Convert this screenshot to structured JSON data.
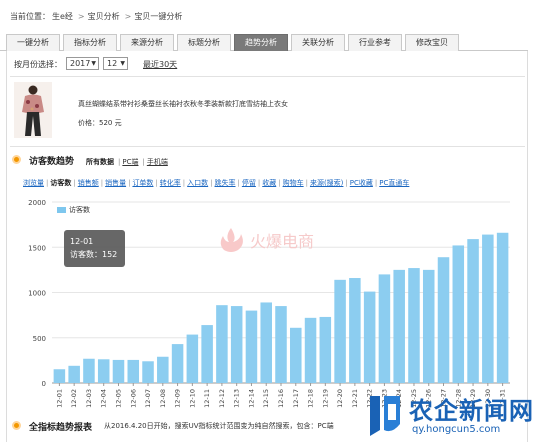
{
  "breadcrumb": {
    "prefix": "当前位置：",
    "items": [
      "生e经",
      "宝贝分析",
      "宝贝一键分析"
    ]
  },
  "tabs": [
    {
      "label": "一键分析",
      "active": false
    },
    {
      "label": "指标分析",
      "active": false
    },
    {
      "label": "来源分析",
      "active": false
    },
    {
      "label": "标题分析",
      "active": false
    },
    {
      "label": "趋势分析",
      "active": true
    },
    {
      "label": "关联分析",
      "active": false
    },
    {
      "label": "行业参考",
      "active": false
    },
    {
      "label": "修改宝贝",
      "active": false
    }
  ],
  "month_filter": {
    "label": "按月份选择：",
    "year": "2017",
    "month": "12",
    "recent_link": "最近30天"
  },
  "product": {
    "title": "真丝蝴蝶结系带衬衫桑蚕丝长袖衬衣秋冬季装新款打底雪纺袖上衣女",
    "price": "价格：520 元"
  },
  "section": {
    "title": "访客数趋势",
    "sub_tabs": [
      "所有数据",
      "PC端",
      "手机端"
    ],
    "active_sub_tab": 0
  },
  "metrics": [
    "浏览量",
    "访客数",
    "销售额",
    "销售量",
    "订单数",
    "转化率",
    "入口数",
    "跳失率",
    "停留",
    "收藏",
    "购物车",
    "来源(搜索)",
    "PC收藏",
    "PC直通车"
  ],
  "active_metric": 1,
  "plain_metric_prefix": "来源(",
  "legend_label": "访客数",
  "tooltip": {
    "date": "12-01",
    "text": "访客数：152"
  },
  "watermark": "火爆电商",
  "footer": {
    "title": "全指标趋势报表",
    "note": "从2016.4.20日开始，搜索UV指标统计范围变为纯自然搜索，包含：PC端"
  },
  "logo": {
    "text": "农企新闻网",
    "sub": "qy.hongcun5.com"
  },
  "colors": {
    "bar": "#8ccdf0",
    "accent": "#f39800",
    "tab_active": "#7a7a7a",
    "link": "#1a66c0"
  },
  "chart_data": {
    "type": "bar",
    "series": [
      {
        "name": "访客数",
        "values": [
          152,
          190,
          268,
          262,
          255,
          255,
          240,
          290,
          430,
          535,
          640,
          860,
          850,
          800,
          890,
          850,
          610,
          720,
          730,
          1140,
          1160,
          1010,
          1200,
          1250,
          1270,
          1250,
          1390,
          1520,
          1590,
          1640,
          1660
        ]
      }
    ],
    "categories": [
      "12-01",
      "12-02",
      "12-03",
      "12-04",
      "12-05",
      "12-06",
      "12-07",
      "12-08",
      "12-09",
      "12-10",
      "12-11",
      "12-12",
      "12-13",
      "12-14",
      "12-15",
      "12-16",
      "12-17",
      "12-18",
      "12-19",
      "12-20",
      "12-21",
      "12-22",
      "12-23",
      "12-24",
      "12-25",
      "12-26",
      "12-27",
      "12-28",
      "12-29",
      "12-30",
      "12-31"
    ],
    "ylim": [
      0,
      2000
    ],
    "yticks": [
      0,
      500,
      1000,
      1500,
      2000
    ],
    "grid": true,
    "legend": "top-left"
  }
}
